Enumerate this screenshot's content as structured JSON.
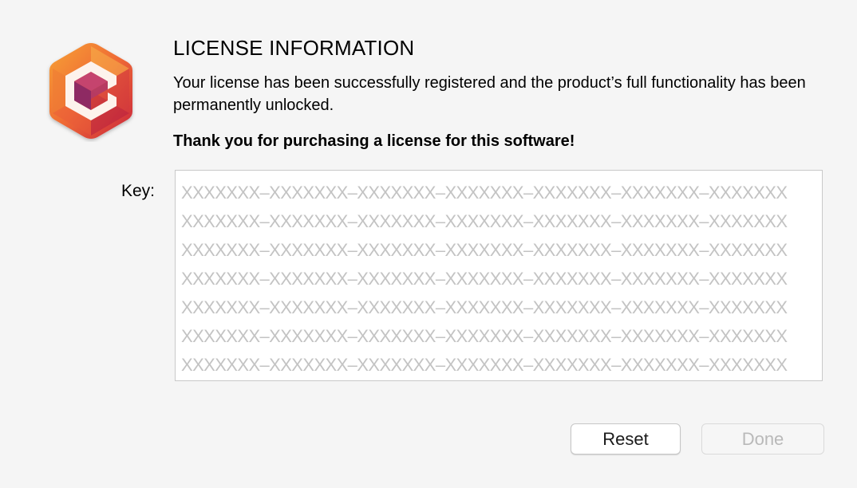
{
  "dialog": {
    "title": "LICENSE INFORMATION",
    "message": "Your license has been successfully registered and the product’s full functionality has been permanently unlocked.",
    "thanks": "Thank you for purchasing a license for this software!",
    "app_icon": "app-logo-icon"
  },
  "key": {
    "label": "Key:",
    "lines": [
      "XXXXXXX–XXXXXXX–XXXXXXX–XXXXXXX–XXXXXXX–XXXXXXX–XXXXXXX",
      "XXXXXXX–XXXXXXX–XXXXXXX–XXXXXXX–XXXXXXX–XXXXXXX–XXXXXXX",
      "XXXXXXX–XXXXXXX–XXXXXXX–XXXXXXX–XXXXXXX–XXXXXXX–XXXXXXX",
      "XXXXXXX–XXXXXXX–XXXXXXX–XXXXXXX–XXXXXXX–XXXXXXX–XXXXXXX",
      "XXXXXXX–XXXXXXX–XXXXXXX–XXXXXXX–XXXXXXX–XXXXXXX–XXXXXXX",
      "XXXXXXX–XXXXXXX–XXXXXXX–XXXXXXX–XXXXXXX–XXXXXXX–XXXXXXX",
      "XXXXXXX–XXXXXXX–XXXXXXX–XXXXXXX–XXXXXXX–XXXXXXX–XXXXXXX"
    ]
  },
  "buttons": {
    "reset_label": "Reset",
    "done_label": "Done",
    "done_enabled": false
  },
  "colors": {
    "background": "#f5f5f5",
    "placeholder_text": "#c3c3c3",
    "disabled_text": "#b9b9b9"
  }
}
